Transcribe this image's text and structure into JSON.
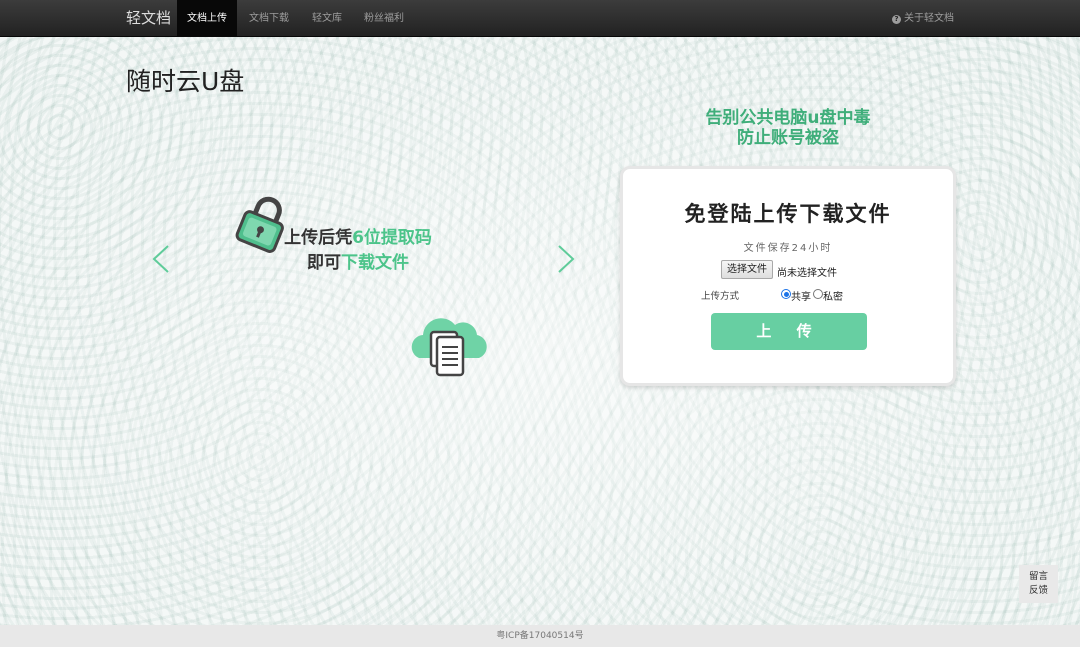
{
  "navbar": {
    "brand": "轻文档",
    "items": [
      {
        "label": "文档上传",
        "active": true
      },
      {
        "label": "文档下载",
        "active": false
      },
      {
        "label": "轻文库",
        "active": false
      },
      {
        "label": "粉丝福利",
        "active": false
      }
    ],
    "about": "关于轻文档"
  },
  "main": {
    "title": "随时云U盘",
    "slogan_line1": "告别公共电脑u盘中毒",
    "slogan_line2": "防止账号被盗"
  },
  "slide": {
    "line1_prefix": "上传后凭",
    "line1_highlight": "6位提取码",
    "line2_prefix": "即可",
    "line2_highlight": "下载文件"
  },
  "card": {
    "title": "免登陆上传下载文件",
    "subtitle": "文件保存24小时",
    "choose_file": "选择文件",
    "no_file": "尚未选择文件",
    "mode_label": "上传方式",
    "option_shared": "共享",
    "option_private": "私密",
    "selected_option": "共享",
    "upload_button": "上 传"
  },
  "footer": {
    "icp": "粤ICP备17040514号"
  },
  "feedback": {
    "line1": "留言",
    "line2": "反馈"
  },
  "colors": {
    "accent": "#67cfa2",
    "highlight": "#4cc48a",
    "navbar": "#222222"
  }
}
